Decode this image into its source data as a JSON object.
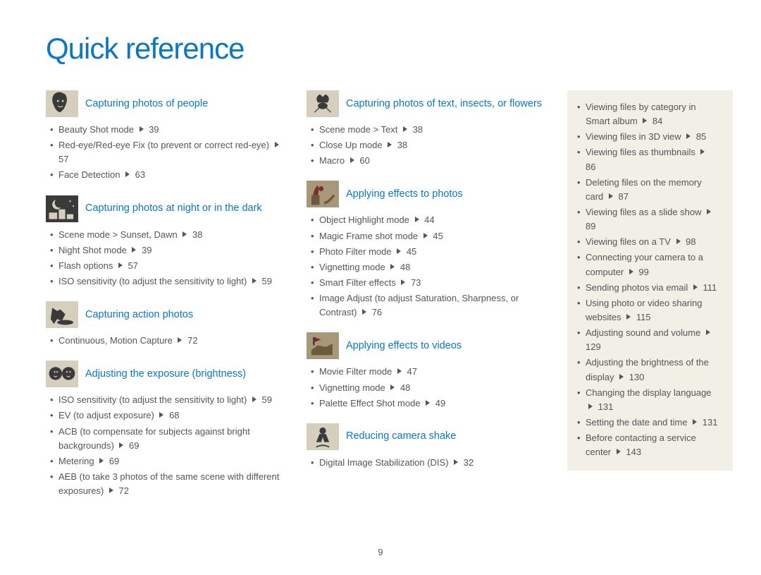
{
  "title": "Quick reference",
  "pageNumber": "9",
  "col1": [
    {
      "title": "Capturing photos of people",
      "icon": "face-icon",
      "items": [
        {
          "text": "Beauty Shot mode",
          "page": "39"
        },
        {
          "text": "Red-eye/Red-eye Fix (to prevent or correct red-eye)",
          "page": "57"
        },
        {
          "text": "Face Detection",
          "page": "63"
        }
      ]
    },
    {
      "title": "Capturing photos at night or in the dark",
      "icon": "night-icon",
      "items": [
        {
          "text": "Scene mode > Sunset, Dawn",
          "page": "38"
        },
        {
          "text": "Night Shot mode",
          "page": "39"
        },
        {
          "text": "Flash options",
          "page": "57"
        },
        {
          "text": "ISO sensitivity (to adjust the sensitivity to light)",
          "page": "59"
        }
      ]
    },
    {
      "title": "Capturing action photos",
      "icon": "action-icon",
      "items": [
        {
          "text": "Continuous, Motion Capture",
          "page": "72"
        }
      ]
    },
    {
      "title": "Adjusting the exposure (brightness)",
      "icon": "exposure-icon",
      "items": [
        {
          "text": "ISO sensitivity (to adjust the sensitivity to light)",
          "page": "59"
        },
        {
          "text": "EV (to adjust exposure)",
          "page": "68"
        },
        {
          "text": "ACB (to compensate for subjects against bright backgrounds)",
          "page": "69"
        },
        {
          "text": "Metering",
          "page": "69"
        },
        {
          "text": "AEB (to take 3 photos of the same scene with different exposures)",
          "page": "72"
        }
      ]
    }
  ],
  "col2": [
    {
      "title": "Capturing  photos of text, insects, or flowers",
      "icon": "insect-icon",
      "items": [
        {
          "text": "Scene mode > Text",
          "page": "38"
        },
        {
          "text": "Close Up mode",
          "page": "38"
        },
        {
          "text": "Macro",
          "page": "60"
        }
      ]
    },
    {
      "title": "Applying effects to photos",
      "icon": "effects-icon",
      "items": [
        {
          "text": "Object Highlight mode",
          "page": "44"
        },
        {
          "text": "Magic Frame shot mode",
          "page": "45"
        },
        {
          "text": "Photo Filter mode",
          "page": "45"
        },
        {
          "text": "Vignetting mode",
          "page": "48"
        },
        {
          "text": "Smart Filter effects",
          "page": "73"
        },
        {
          "text": "Image Adjust (to adjust Saturation, Sharpness, or Contrast)",
          "page": "76"
        }
      ]
    },
    {
      "title": "Applying effects to videos",
      "icon": "video-icon",
      "items": [
        {
          "text": "Movie Filter mode",
          "page": "47"
        },
        {
          "text": "Vignetting mode",
          "page": "48"
        },
        {
          "text": "Palette Effect Shot mode",
          "page": "49"
        }
      ]
    },
    {
      "title": "Reducing camera shake",
      "icon": "shake-icon",
      "items": [
        {
          "text": "Digital Image Stabilization (DIS)",
          "page": "32"
        }
      ]
    }
  ],
  "side": [
    {
      "text": "Viewing files by category in Smart album",
      "page": "84"
    },
    {
      "text": "Viewing files in 3D view",
      "page": "85"
    },
    {
      "text": "Viewing files as thumbnails",
      "page": "86"
    },
    {
      "text": "Deleting files on the memory card",
      "page": "87"
    },
    {
      "text": "Viewing files as a slide show",
      "page": "89"
    },
    {
      "text": "Viewing files on a TV",
      "page": "98"
    },
    {
      "text": "Connecting your camera to a computer",
      "page": "99"
    },
    {
      "text": "Sending photos via email",
      "page": "111"
    },
    {
      "text": "Using photo or video sharing websites",
      "page": "115"
    },
    {
      "text": "Adjusting sound and volume",
      "page": "129"
    },
    {
      "text": "Adjusting the brightness of the display",
      "page": "130"
    },
    {
      "text": "Changing the display language",
      "page": "131"
    },
    {
      "text": "Setting the date and time",
      "page": "131"
    },
    {
      "text": "Before contacting a service center",
      "page": "143"
    }
  ]
}
